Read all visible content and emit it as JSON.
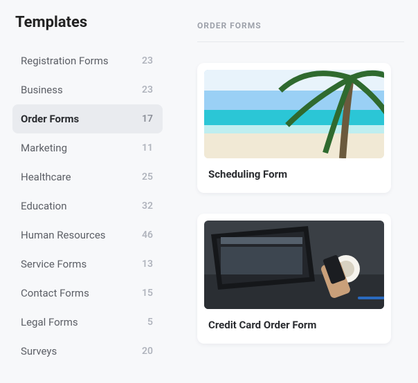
{
  "sidebar": {
    "title": "Templates",
    "items": [
      {
        "label": "Registration Forms",
        "count": 23,
        "active": false
      },
      {
        "label": "Business",
        "count": 23,
        "active": false
      },
      {
        "label": "Order Forms",
        "count": 17,
        "active": true
      },
      {
        "label": "Marketing",
        "count": 11,
        "active": false
      },
      {
        "label": "Healthcare",
        "count": 25,
        "active": false
      },
      {
        "label": "Education",
        "count": 32,
        "active": false
      },
      {
        "label": "Human Resources",
        "count": 46,
        "active": false
      },
      {
        "label": "Service Forms",
        "count": 13,
        "active": false
      },
      {
        "label": "Contact Forms",
        "count": 15,
        "active": false
      },
      {
        "label": "Legal Forms",
        "count": 5,
        "active": false
      },
      {
        "label": "Surveys",
        "count": 20,
        "active": false
      }
    ]
  },
  "main": {
    "section_header": "ORDER FORMS",
    "cards": [
      {
        "title": "Scheduling Form",
        "image_kind": "beach-palm"
      },
      {
        "title": "Credit Card Order Form",
        "image_kind": "laptop-desk"
      }
    ]
  }
}
